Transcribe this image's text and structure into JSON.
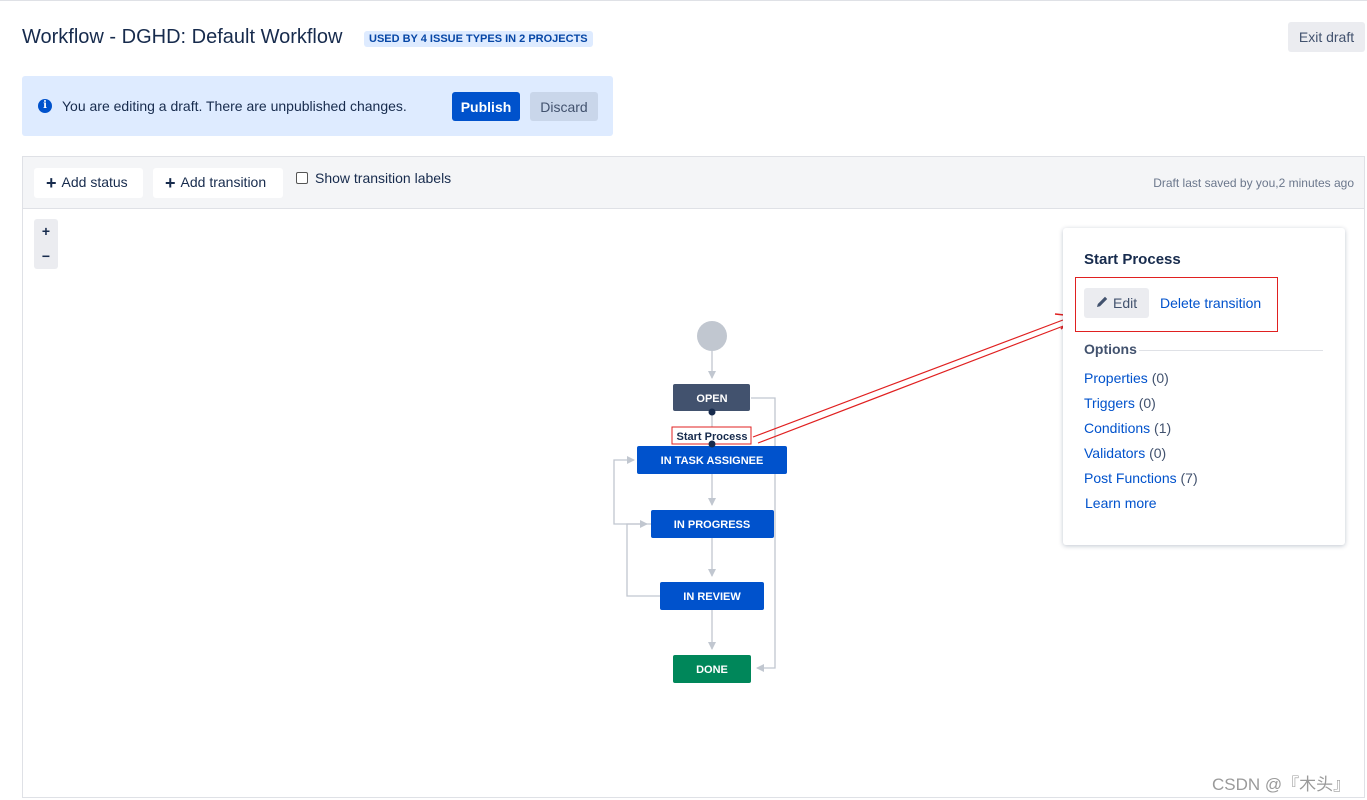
{
  "header": {
    "title": "Workflow - DGHD: Default Workflow",
    "lozenge": "USED BY 4 ISSUE TYPES IN 2 PROJECTS",
    "exit_draft": "Exit draft"
  },
  "banner": {
    "message": "You are editing a draft. There are unpublished changes.",
    "publish": "Publish",
    "discard": "Discard",
    "icon": "info-icon"
  },
  "toolbar": {
    "add_status": "Add status",
    "add_transition": "Add transition",
    "show_transition_labels": "Show transition labels",
    "show_transition_labels_checked": false,
    "draft_saved": "Draft last saved by you,2 minutes ago"
  },
  "zoom": {
    "in": "+",
    "out": "−"
  },
  "diagram": {
    "statuses": [
      {
        "id": "open",
        "label": "OPEN",
        "color": "#42526e"
      },
      {
        "id": "in_task_assignee",
        "label": "IN TASK ASSIGNEE",
        "color": "#0052cc"
      },
      {
        "id": "in_progress",
        "label": "IN PROGRESS",
        "color": "#0052cc"
      },
      {
        "id": "in_review",
        "label": "IN REVIEW",
        "color": "#0052cc"
      },
      {
        "id": "done",
        "label": "DONE",
        "color": "#00875a"
      }
    ],
    "selected_transition_label": "Start Process"
  },
  "side_panel": {
    "title": "Start Process",
    "edit": "Edit",
    "delete_transition": "Delete transition",
    "options_heading": "Options",
    "options": [
      {
        "label": "Properties",
        "count": "(0)"
      },
      {
        "label": "Triggers",
        "count": "(0)"
      },
      {
        "label": "Conditions",
        "count": "(1)"
      },
      {
        "label": "Validators",
        "count": "(0)"
      },
      {
        "label": "Post Functions",
        "count": "(7)"
      }
    ],
    "learn_more": "Learn more"
  },
  "watermark": "CSDN @『木头』",
  "colors": {
    "primary": "#0052cc",
    "open_status": "#42526e",
    "done_status": "#00875a",
    "annotation_red": "#e02020",
    "banner_bg": "#deebff"
  }
}
